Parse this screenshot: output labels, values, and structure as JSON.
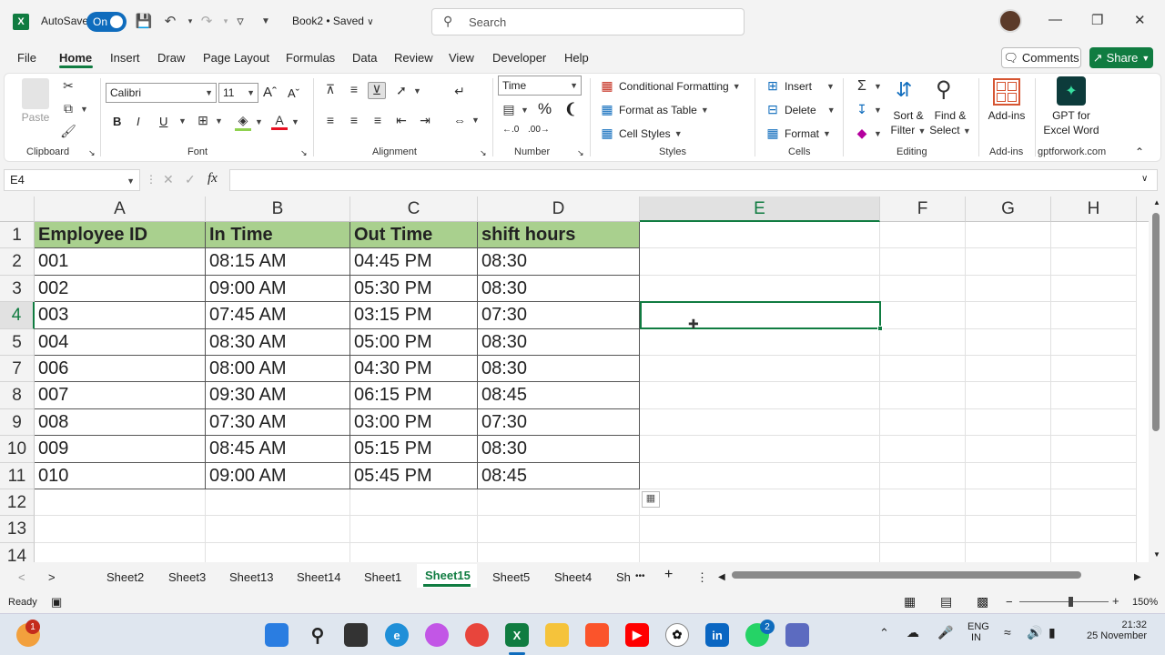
{
  "titlebar": {
    "app_logo": "X",
    "autosave_label": "AutoSave",
    "autosave_state": "On",
    "doc_title": "Book2 • Saved",
    "search_placeholder": "Search"
  },
  "menu": {
    "items": [
      "File",
      "Home",
      "Insert",
      "Draw",
      "Page Layout",
      "Formulas",
      "Data",
      "Review",
      "View",
      "Developer",
      "Help"
    ],
    "active": "Home",
    "comments_label": "Comments",
    "share_label": "Share"
  },
  "ribbon": {
    "clipboard": {
      "paste": "Paste",
      "label": "Clipboard"
    },
    "font": {
      "name": "Calibri",
      "size": "11",
      "label": "Font",
      "bold": "B",
      "italic": "I",
      "underline": "U"
    },
    "alignment": {
      "label": "Alignment"
    },
    "number": {
      "format": "Time",
      "label": "Number"
    },
    "styles": {
      "conditional": "Conditional Formatting",
      "format_table": "Format as Table",
      "cell_styles": "Cell Styles",
      "label": "Styles"
    },
    "cells": {
      "insert": "Insert",
      "delete": "Delete",
      "format": "Format",
      "label": "Cells"
    },
    "editing": {
      "sort_filter_1": "Sort &",
      "sort_filter_2": "Filter",
      "find_select_1": "Find &",
      "find_select_2": "Select",
      "label": "Editing"
    },
    "addins": {
      "addins": "Add-ins",
      "label": "Add-ins"
    },
    "gpt": {
      "line1": "GPT for",
      "line2": "Excel Word",
      "label": "gptforwork.com"
    }
  },
  "formula_bar": {
    "name_box": "E4",
    "fx": "fx",
    "value": ""
  },
  "grid": {
    "columns": [
      "A",
      "B",
      "C",
      "D",
      "E",
      "F",
      "G",
      "H"
    ],
    "selected_column": "E",
    "selected_row": "4",
    "rows": [
      {
        "num": "1",
        "cells": [
          "Employee ID",
          "In Time",
          "Out Time",
          "shift hours"
        ]
      },
      {
        "num": "2",
        "cells": [
          "001",
          "08:15 AM",
          "04:45 PM",
          "08:30"
        ]
      },
      {
        "num": "3",
        "cells": [
          "002",
          "09:00 AM",
          "05:30 PM",
          "08:30"
        ]
      },
      {
        "num": "4",
        "cells": [
          "003",
          "07:45 AM",
          "03:15 PM",
          "07:30"
        ]
      },
      {
        "num": "5",
        "cells": [
          "004",
          "08:30 AM",
          "05:00 PM",
          "08:30"
        ]
      },
      {
        "num": "7",
        "cells": [
          "006",
          "08:00 AM",
          "04:30 PM",
          "08:30"
        ]
      },
      {
        "num": "8",
        "cells": [
          "007",
          "09:30 AM",
          "06:15 PM",
          "08:45"
        ]
      },
      {
        "num": "9",
        "cells": [
          "008",
          "07:30 AM",
          "03:00 PM",
          "07:30"
        ]
      },
      {
        "num": "10",
        "cells": [
          "009",
          "08:45 AM",
          "05:15 PM",
          "08:30"
        ]
      },
      {
        "num": "11",
        "cells": [
          "010",
          "09:00 AM",
          "05:45 PM",
          "08:45"
        ]
      },
      {
        "num": "12",
        "cells": [
          "",
          "",
          "",
          ""
        ]
      },
      {
        "num": "13",
        "cells": [
          "",
          "",
          "",
          ""
        ]
      },
      {
        "num": "14",
        "cells": [
          "",
          "",
          "",
          ""
        ]
      }
    ]
  },
  "sheets": {
    "tabs": [
      "Sheet2",
      "Sheet3",
      "Sheet13",
      "Sheet14",
      "Sheet1",
      "Sheet15",
      "Sheet5",
      "Sheet4",
      "Sh"
    ],
    "active": "Sheet15",
    "more": "•••",
    "add": "+"
  },
  "status": {
    "state": "Ready",
    "zoom": "150%"
  },
  "taskbar": {
    "lang_1": "ENG",
    "lang_2": "IN",
    "time": "21:32",
    "date": "25 November",
    "badge_left": "1",
    "badge_whatsapp": "2"
  },
  "colors": {
    "excel_green": "#107c41",
    "header_fill": "#a9d08e"
  }
}
